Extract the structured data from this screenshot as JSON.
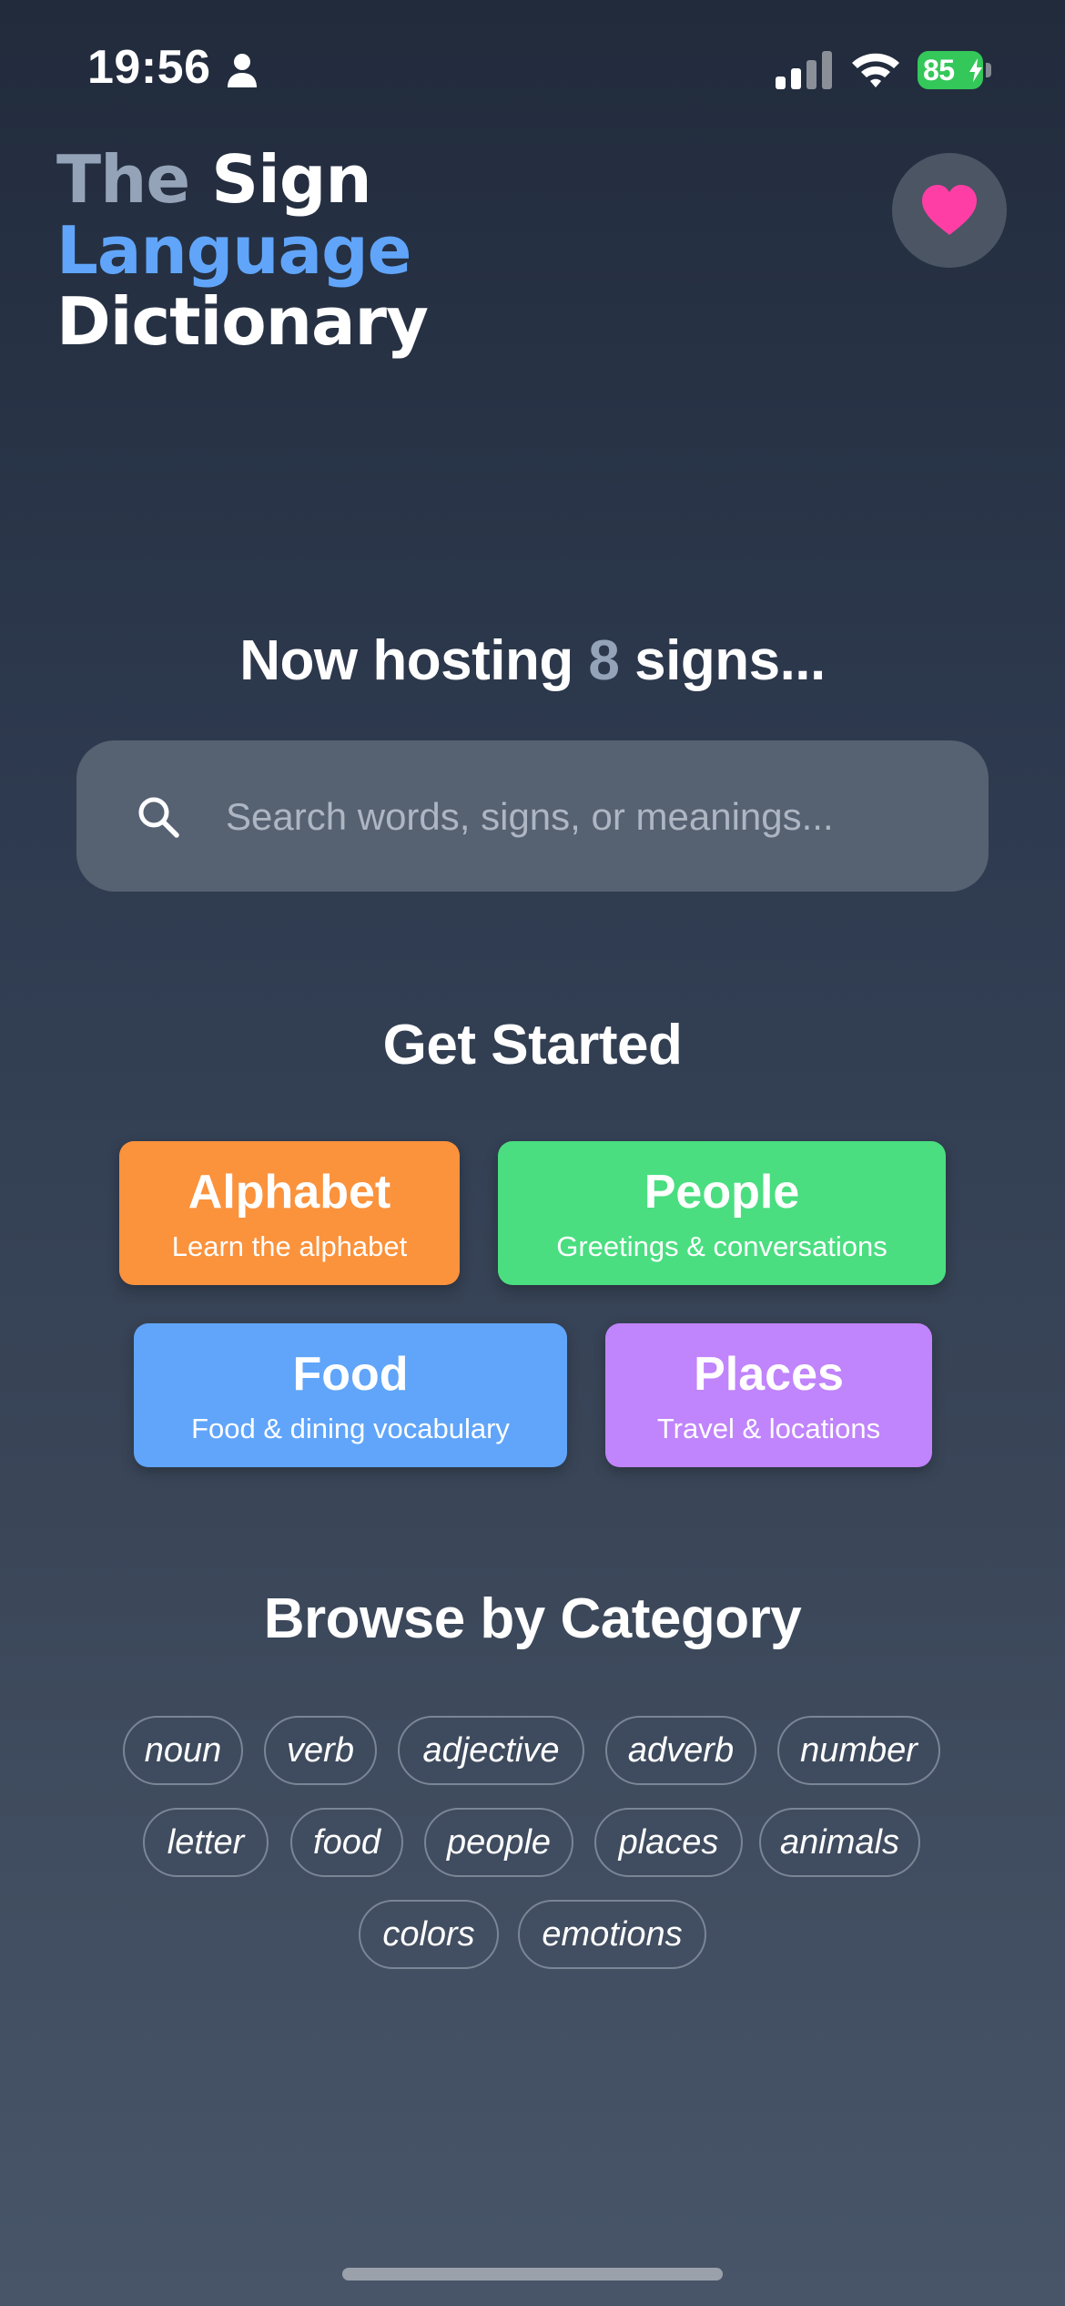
{
  "status_bar": {
    "time": "19:56",
    "battery_percent": "85"
  },
  "header": {
    "title_the": "The",
    "title_sign": "Sign",
    "title_language": "Language",
    "title_dictionary": "Dictionary",
    "favorites_icon": "heart-icon"
  },
  "hosting": {
    "prefix": "Now hosting ",
    "count": "8",
    "suffix": " signs..."
  },
  "search": {
    "placeholder": "Search words, signs, or meanings...",
    "value": "",
    "icon": "search-icon"
  },
  "get_started": {
    "title": "Get Started",
    "cards": [
      {
        "title": "Alphabet",
        "subtitle": "Learn the alphabet",
        "color": "#fb923c"
      },
      {
        "title": "People",
        "subtitle": "Greetings & conversations",
        "color": "#4ade80"
      },
      {
        "title": "Food",
        "subtitle": "Food & dining vocabulary",
        "color": "#60a5fa"
      },
      {
        "title": "Places",
        "subtitle": "Travel & locations",
        "color": "#c084fc"
      }
    ]
  },
  "browse": {
    "title": "Browse by Category",
    "tags": [
      "noun",
      "verb",
      "adjective",
      "adverb",
      "number",
      "letter",
      "food",
      "people",
      "places",
      "animals",
      "colors",
      "emotions"
    ]
  },
  "colors": {
    "accent_blue": "#60a5fa",
    "muted_gray": "#94a3b8",
    "heart_pink": "#ff3ea5",
    "battery_green": "#34c759"
  }
}
